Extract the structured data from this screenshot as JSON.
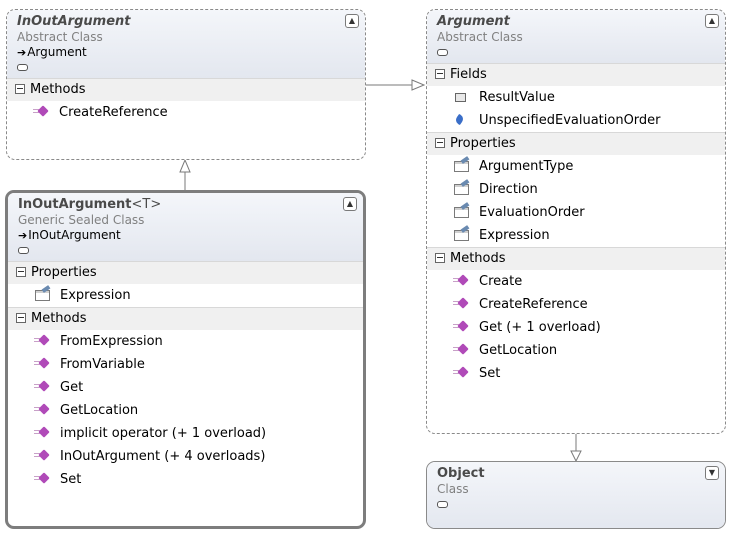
{
  "classes": {
    "inoutargument": {
      "name": "InOutArgument",
      "kind": "Abstract Class",
      "base": "Argument",
      "sections": {
        "methods": "Methods"
      },
      "methods": [
        "CreateReference"
      ]
    },
    "argument": {
      "name": "Argument",
      "kind": "Abstract Class",
      "sections": {
        "fields": "Fields",
        "properties": "Properties",
        "methods": "Methods"
      },
      "fields": [
        "ResultValue",
        "UnspecifiedEvaluationOrder"
      ],
      "properties": [
        "ArgumentType",
        "Direction",
        "EvaluationOrder",
        "Expression"
      ],
      "methods": [
        "Create",
        "CreateReference",
        "Get (+ 1 overload)",
        "GetLocation",
        "Set"
      ]
    },
    "inoutargument_t": {
      "name": "InOutArgument",
      "generic": "<T>",
      "kind": "Generic Sealed Class",
      "base": "InOutArgument",
      "sections": {
        "properties": "Properties",
        "methods": "Methods"
      },
      "properties": [
        "Expression"
      ],
      "methods": [
        "FromExpression",
        "FromVariable",
        "Get",
        "GetLocation",
        "implicit operator (+ 1 overload)",
        "InOutArgument (+ 4 overloads)",
        "Set"
      ]
    },
    "object": {
      "name": "Object",
      "kind": "Class"
    }
  },
  "icons": {
    "collapse": "double-chevron-up-icon",
    "expand": "double-chevron-down-icon",
    "inheritance": "inheritance-arrow-icon",
    "method": "method-icon",
    "property": "property-icon",
    "field": "field-icon",
    "enum": "enum-field-icon"
  }
}
